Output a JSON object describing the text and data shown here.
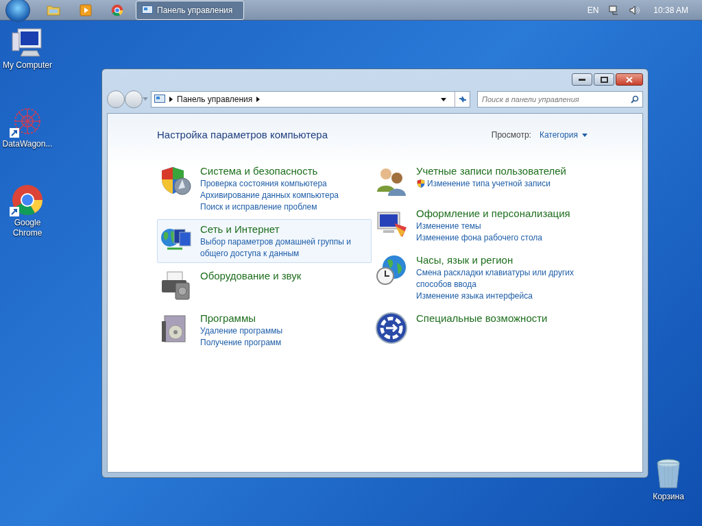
{
  "taskbar": {
    "pinned": [
      {
        "kind": "folder"
      },
      {
        "kind": "media"
      },
      {
        "kind": "chrome"
      }
    ],
    "windows": [
      {
        "title": "Панель управления",
        "selected": true
      }
    ],
    "tray": {
      "language": "EN",
      "time": "10:38 AM"
    }
  },
  "desktop_icons": [
    {
      "label": "My Computer",
      "kind": "computer",
      "shortcut": false
    },
    {
      "label": "DataWagon...",
      "kind": "datawagon",
      "shortcut": true
    },
    {
      "label": "Google Chrome",
      "kind": "chrome",
      "shortcut": true
    },
    {
      "label": "Корзина",
      "kind": "recycle",
      "shortcut": false
    }
  ],
  "window": {
    "breadcrumb": [
      "Панель управления"
    ],
    "search": {
      "placeholder": "Поиск в панели управления"
    },
    "heading": "Настройка параметров компьютера",
    "view": {
      "label": "Просмотр:",
      "value": "Категория"
    },
    "columns": [
      [
        {
          "kind": "security",
          "title": "Система и безопасность",
          "highlighted": false,
          "links": [
            {
              "text": "Проверка состояния компьютера",
              "shield": false
            },
            {
              "text": "Архивирование данных компьютера",
              "shield": false
            },
            {
              "text": "Поиск и исправление проблем",
              "shield": false
            }
          ]
        },
        {
          "kind": "network",
          "title": "Сеть и Интернет",
          "highlighted": true,
          "links": [
            {
              "text": "Выбор параметров домашней группы и общего доступа к данным",
              "shield": false
            }
          ]
        },
        {
          "kind": "hardware",
          "title": "Оборудование и звук",
          "highlighted": false
        },
        {
          "kind": "programs",
          "title": "Программы",
          "highlighted": false,
          "links": [
            {
              "text": "Удаление программы",
              "shield": false
            },
            {
              "text": "Получение программ",
              "shield": false
            }
          ]
        }
      ],
      [
        {
          "kind": "users",
          "title": "Учетные записи пользователей",
          "highlighted": false,
          "links": [
            {
              "text": "Изменение типа учетной записи",
              "shield": true
            }
          ]
        },
        {
          "kind": "appearance",
          "title": "Оформление и персонализация",
          "highlighted": false,
          "links": [
            {
              "text": "Изменение темы",
              "shield": false
            },
            {
              "text": "Изменение фона рабочего стола",
              "shield": false
            }
          ]
        },
        {
          "kind": "clock",
          "title": "Часы, язык и регион",
          "highlighted": false,
          "links": [
            {
              "text": "Смена раскладки клавиатуры или других способов ввода",
              "shield": false
            },
            {
              "text": "Изменение языка интерфейса",
              "shield": false
            }
          ]
        },
        {
          "kind": "access",
          "title": "Специальные возможности",
          "highlighted": false
        }
      ]
    ]
  }
}
